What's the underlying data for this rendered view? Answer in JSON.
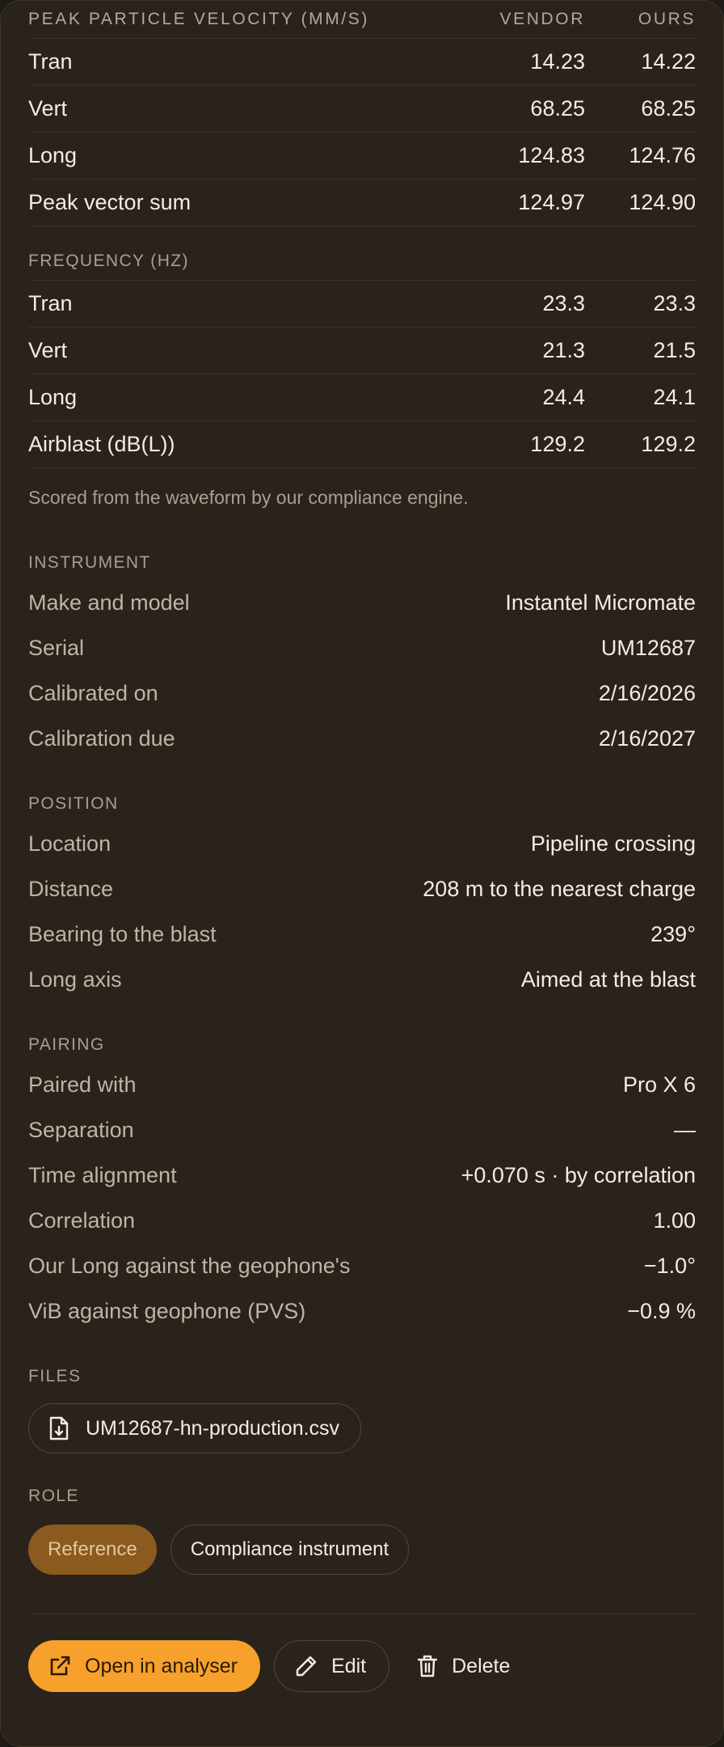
{
  "ppv": {
    "header": {
      "label": "Peak particle velocity (mm/s)",
      "vendor": "Vendor",
      "ours": "Ours"
    },
    "rows": [
      {
        "label": "Tran",
        "vendor": "14.23",
        "ours": "14.22"
      },
      {
        "label": "Vert",
        "vendor": "68.25",
        "ours": "68.25"
      },
      {
        "label": "Long",
        "vendor": "124.83",
        "ours": "124.76"
      },
      {
        "label": "Peak vector sum",
        "vendor": "124.97",
        "ours": "124.90"
      }
    ]
  },
  "frequency": {
    "header": "Frequency (Hz)",
    "rows": [
      {
        "label": "Tran",
        "vendor": "23.3",
        "ours": "23.3"
      },
      {
        "label": "Vert",
        "vendor": "21.3",
        "ours": "21.5"
      },
      {
        "label": "Long",
        "vendor": "24.4",
        "ours": "24.1"
      },
      {
        "label": "Airblast (dB(L))",
        "vendor": "129.2",
        "ours": "129.2"
      }
    ]
  },
  "note": "Scored from the waveform by our compliance engine.",
  "instrument": {
    "title": "Instrument",
    "rows": [
      {
        "key": "Make and model",
        "value": "Instantel Micromate"
      },
      {
        "key": "Serial",
        "value": "UM12687"
      },
      {
        "key": "Calibrated on",
        "value": "2/16/2026"
      },
      {
        "key": "Calibration due",
        "value": "2/16/2027"
      }
    ]
  },
  "position": {
    "title": "Position",
    "rows": [
      {
        "key": "Location",
        "value": "Pipeline crossing"
      },
      {
        "key": "Distance",
        "value": "208 m to the nearest charge"
      },
      {
        "key": "Bearing to the blast",
        "value": "239°"
      },
      {
        "key": "Long axis",
        "value": "Aimed at the blast"
      }
    ]
  },
  "pairing": {
    "title": "Pairing",
    "rows": [
      {
        "key": "Paired with",
        "value": "Pro X 6"
      },
      {
        "key": "Separation",
        "value": "—"
      },
      {
        "key": "Time alignment",
        "value": "+0.070 s · by correlation"
      },
      {
        "key": "Correlation",
        "value": "1.00"
      },
      {
        "key": "Our Long against the geophone's",
        "value": "−1.0°"
      },
      {
        "key": "ViB against geophone (PVS)",
        "value": "−0.9 %"
      }
    ]
  },
  "files": {
    "title": "Files",
    "file_name": "UM12687-hn-production.csv",
    "icon": "file-download-icon"
  },
  "role": {
    "title": "Role",
    "options": [
      {
        "label": "Reference",
        "selected": true
      },
      {
        "label": "Compliance instrument",
        "selected": false
      }
    ]
  },
  "actions": {
    "open_label": "Open in analyser",
    "edit_label": "Edit",
    "delete_label": "Delete"
  },
  "colors": {
    "panel_bg": "#2a231b",
    "accent": "#f7a02b",
    "selected_pill": "#8a5a1e"
  }
}
